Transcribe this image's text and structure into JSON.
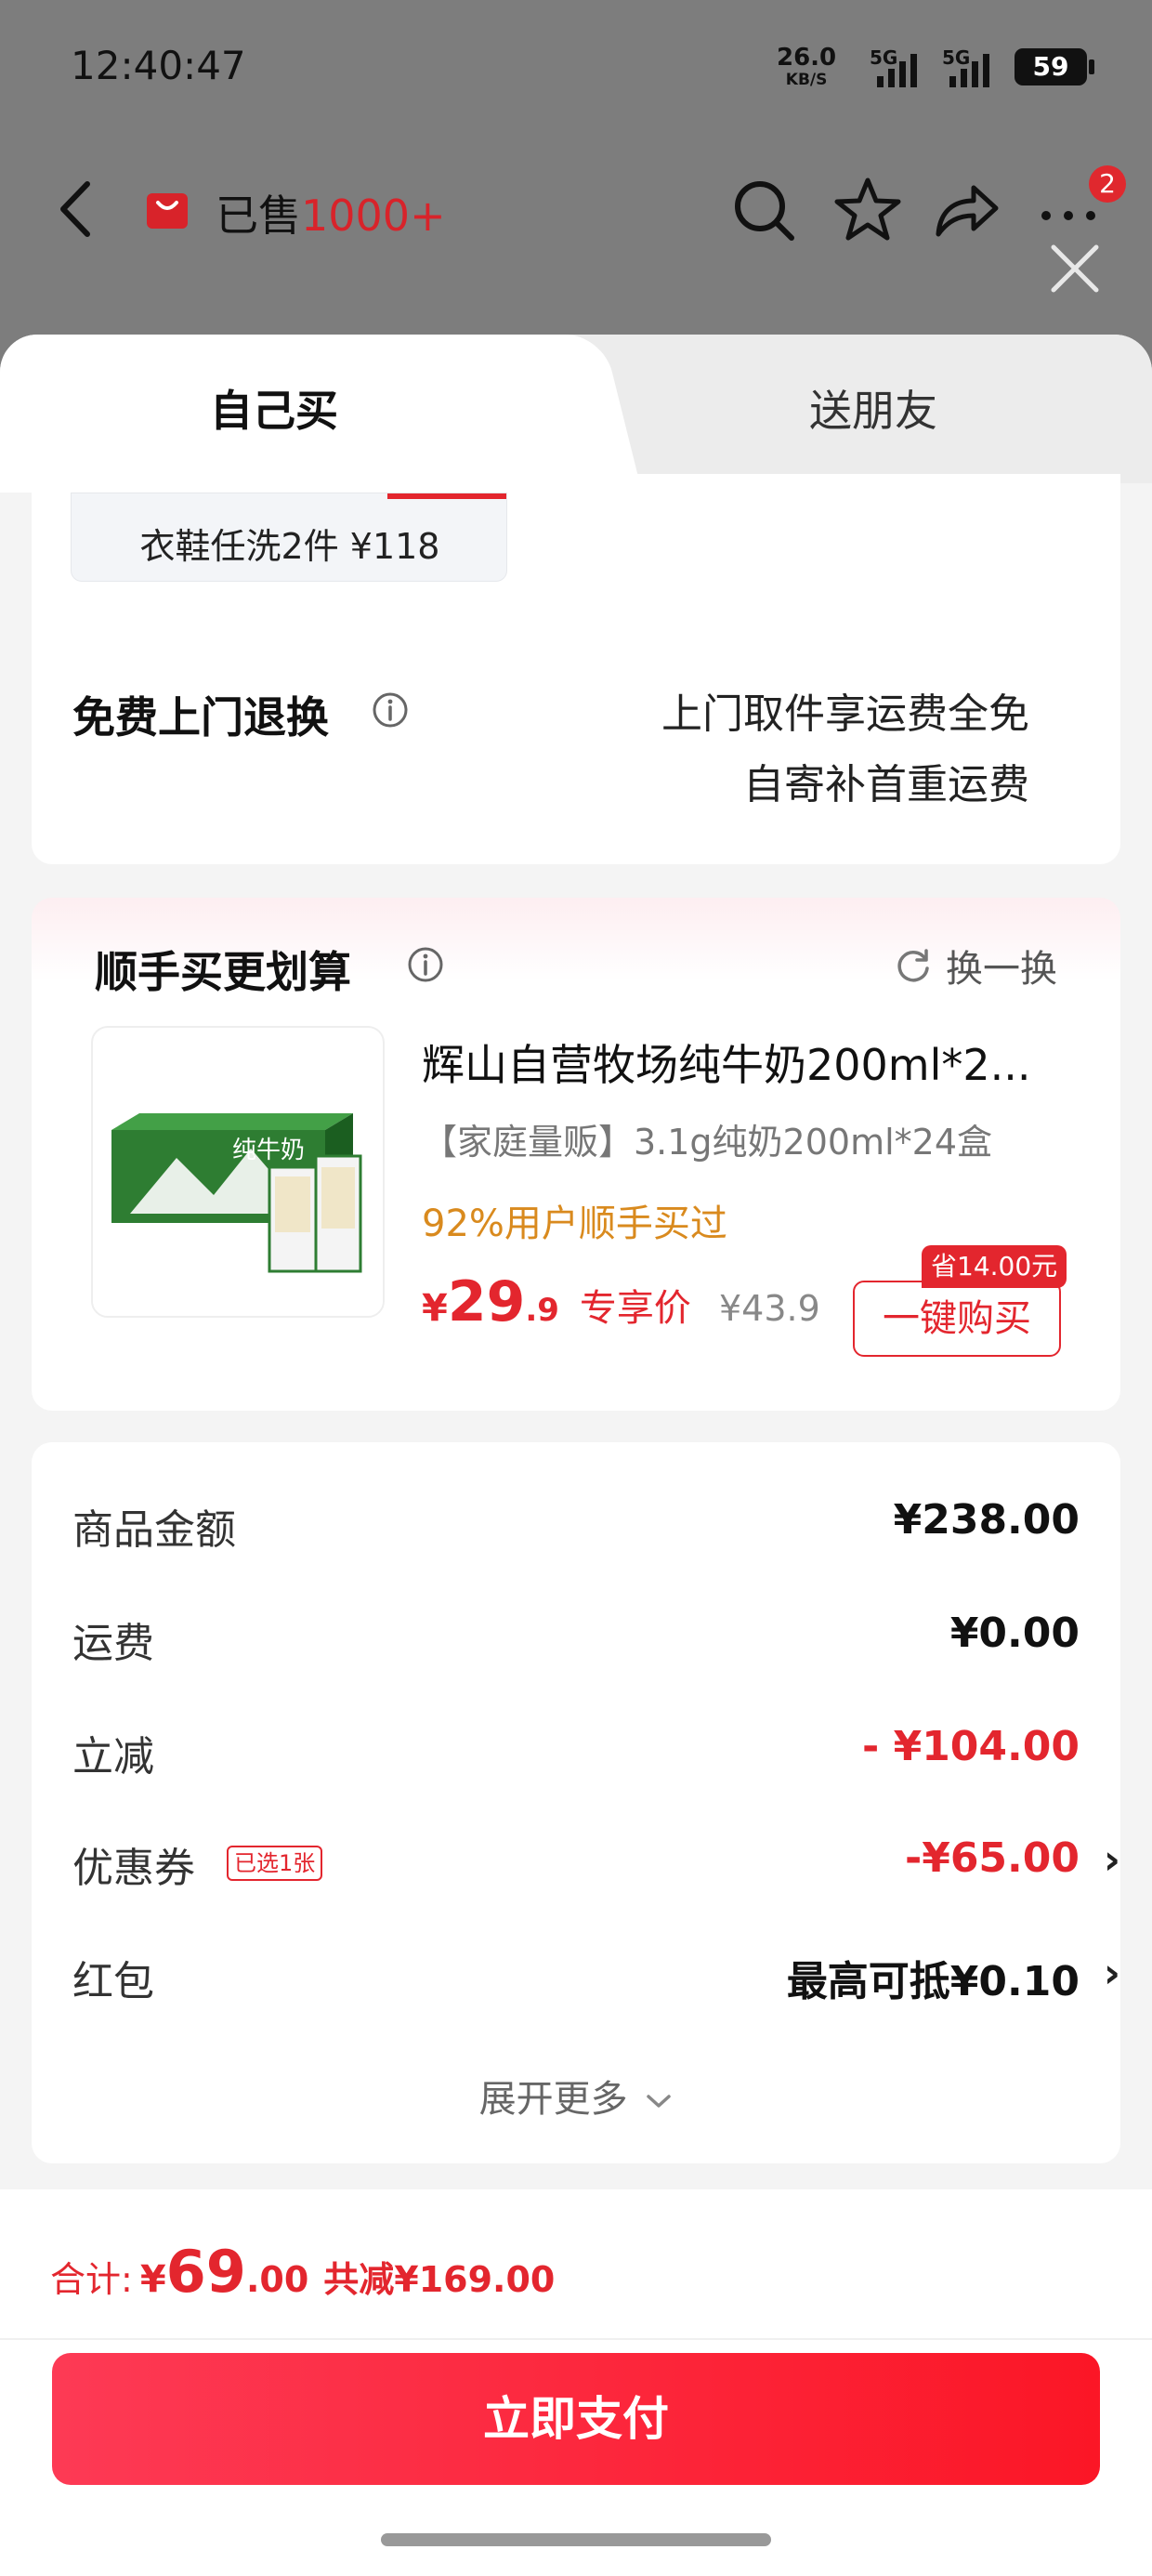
{
  "status_bar": {
    "time": "12:40:47",
    "net_speed": "26.0",
    "net_unit": "KB/S",
    "sig1": "5G",
    "sig2": "5G",
    "battery": "59"
  },
  "nav": {
    "sold_prefix": "已售",
    "sold_count": "1000+",
    "badge_count": "2"
  },
  "tabs": {
    "self": "自己买",
    "friend": "送朋友"
  },
  "service": {
    "chip_text": "衣鞋任洗2件  ¥118",
    "return_title": "免费上门退换",
    "return_line1": "上门取件享运费全免",
    "return_line2": "自寄补首重运费"
  },
  "recommend": {
    "title": "顺手买更划算",
    "refresh_label": "换一换",
    "product_name": "辉山自营牧场纯牛奶200ml*2...",
    "product_spec": "【家庭量贩】3.1g纯奶200ml*24盒",
    "product_rate": "92%用户顺手买过",
    "price_currency": "¥",
    "price_int": "29",
    "price_dec": ".9",
    "price_tag": "专享价",
    "old_price": "¥43.9",
    "save_tag": "省14.00元",
    "buy_label": "一键购买",
    "box_label": "纯牛奶"
  },
  "summary": {
    "goods_label": "商品金额",
    "goods_value": "¥238.00",
    "shipping_label": "运费",
    "shipping_value": "¥0.00",
    "discount_label": "立减",
    "discount_value": "- ¥104.00",
    "coupon_label": "优惠券",
    "coupon_badge": "已选1张",
    "coupon_value": "-¥65.00",
    "redpacket_label": "红包",
    "redpacket_value": "最高可抵¥0.10",
    "expand_label": "展开更多"
  },
  "footer": {
    "total_label": "合计:",
    "total_currency": "¥",
    "total_int": "69",
    "total_dec": ".00",
    "total_reduce": "共减¥169.00",
    "pay_label": "立即支付"
  }
}
